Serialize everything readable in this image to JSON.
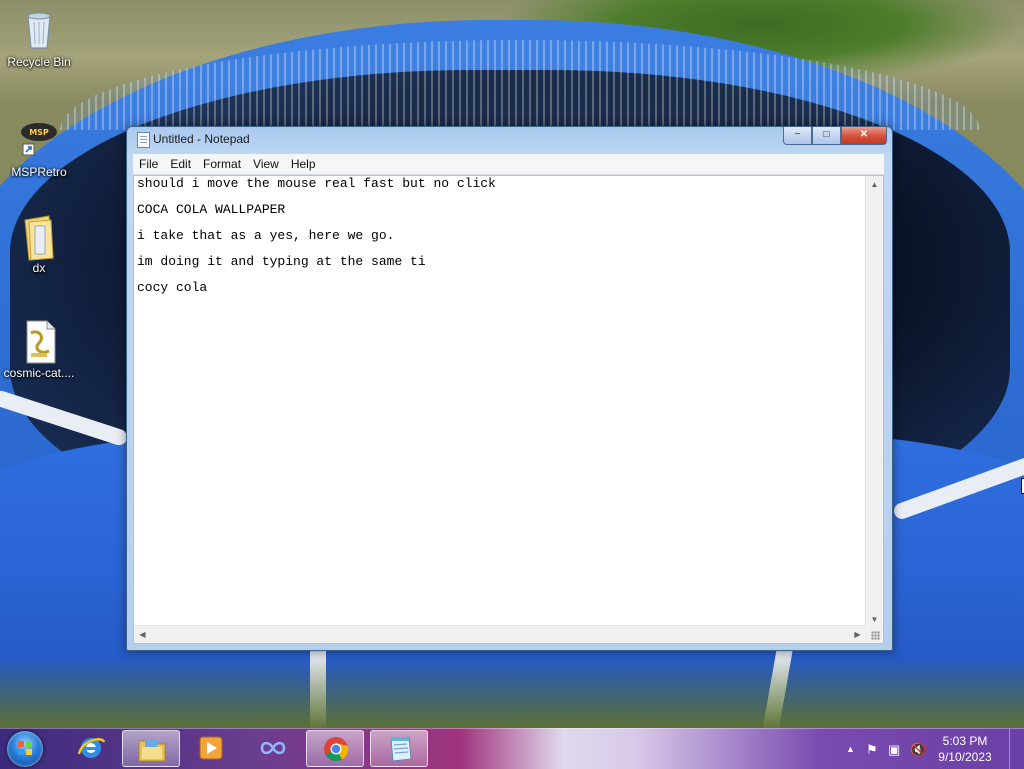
{
  "desktop": {
    "icons": [
      {
        "label": "Recycle Bin",
        "icon": "recycle-bin-icon"
      },
      {
        "label": "MSPRetro",
        "icon": "msp-retro-icon"
      },
      {
        "label": "dx",
        "icon": "folder-icon"
      },
      {
        "label": "cosmic-cat....",
        "icon": "script-file-icon"
      }
    ]
  },
  "notepad": {
    "title": "Untitled - Notepad",
    "menu": [
      "File",
      "Edit",
      "Format",
      "View",
      "Help"
    ],
    "lines": [
      "should i move the mouse real fast but no click",
      "COCA COLA WALLPAPER",
      "i take that as a yes, here we go.",
      "im doing it and typing at the same ti",
      "cocy cola"
    ],
    "caption_buttons": {
      "minimize": "−",
      "maximize": "□",
      "close": "✕"
    }
  },
  "taskbar": {
    "pinned": [
      {
        "name": "internet-explorer-icon"
      },
      {
        "name": "file-explorer-icon"
      },
      {
        "name": "media-player-icon"
      },
      {
        "name": "infinity-app-icon"
      },
      {
        "name": "chrome-icon"
      },
      {
        "name": "notepad-icon"
      }
    ],
    "tray": {
      "time": "5:03 PM",
      "date": "9/10/2023"
    }
  },
  "colors": {
    "taskbar_accent": "#6a3d8f",
    "window_frame": "#a9c9ee",
    "pool_blue": "#2f6fd6"
  }
}
